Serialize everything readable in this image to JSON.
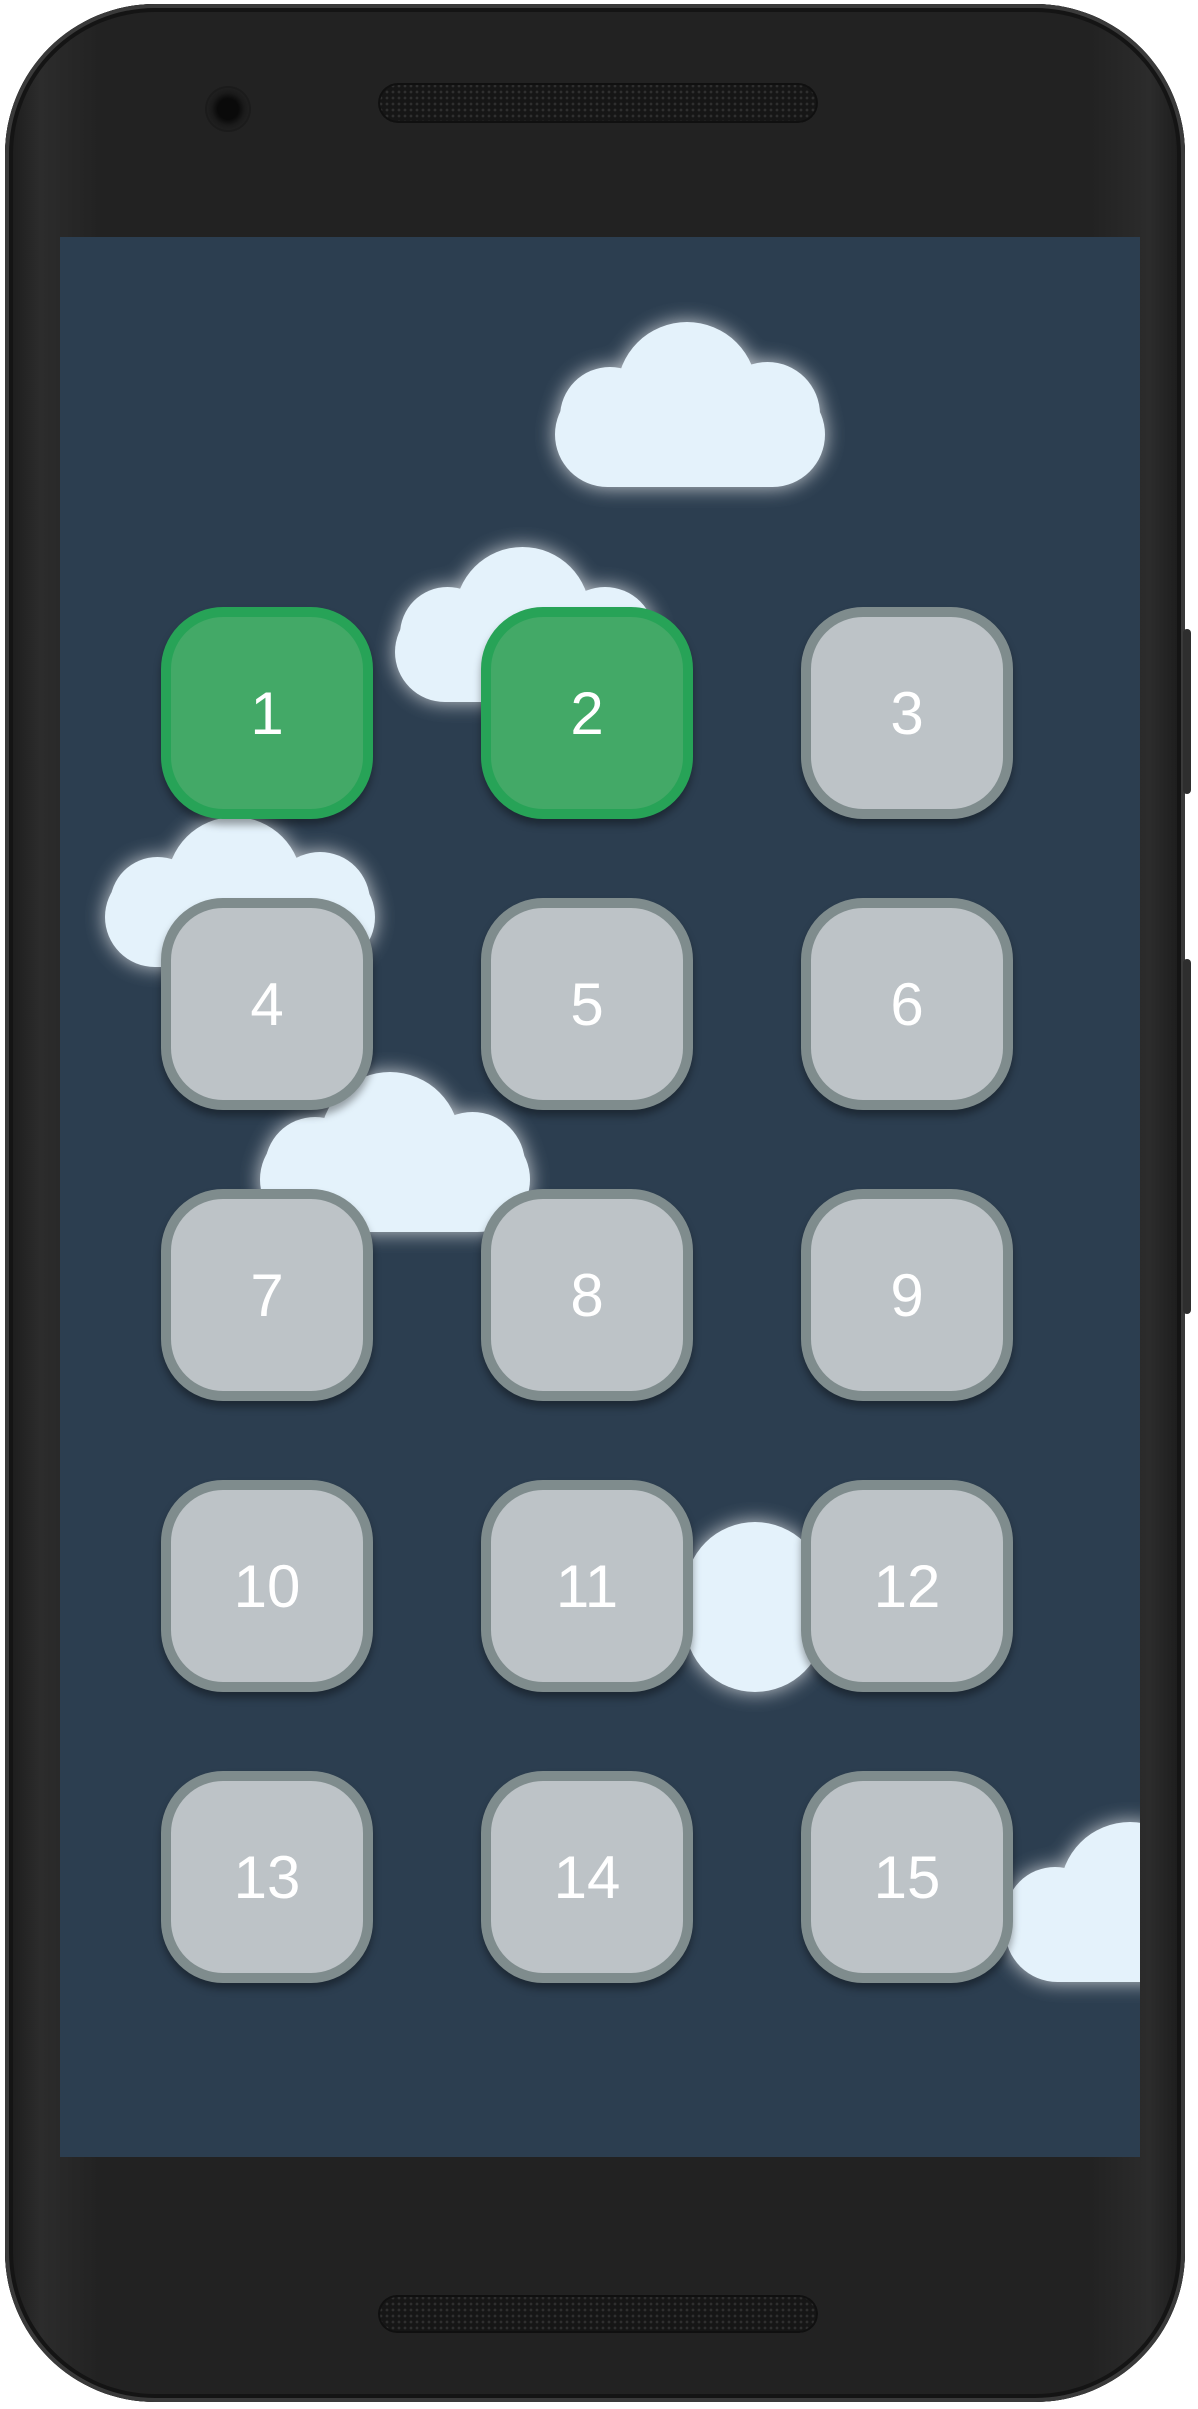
{
  "colors": {
    "screen_background": "#2c3e50",
    "level_unlocked_fill": "#43a967",
    "level_unlocked_border": "#27a357",
    "level_locked_fill": "#bdc3c7",
    "level_locked_border": "#7f8c8d",
    "level_text": "#ffffff",
    "cloud": "#e4f2fb"
  },
  "levels": [
    {
      "label": "1",
      "state": "unlocked"
    },
    {
      "label": "2",
      "state": "unlocked"
    },
    {
      "label": "3",
      "state": "locked"
    },
    {
      "label": "4",
      "state": "locked"
    },
    {
      "label": "5",
      "state": "locked"
    },
    {
      "label": "6",
      "state": "locked"
    },
    {
      "label": "7",
      "state": "locked"
    },
    {
      "label": "8",
      "state": "locked"
    },
    {
      "label": "9",
      "state": "locked"
    },
    {
      "label": "10",
      "state": "locked"
    },
    {
      "label": "11",
      "state": "locked"
    },
    {
      "label": "12",
      "state": "locked"
    },
    {
      "label": "13",
      "state": "locked"
    },
    {
      "label": "14",
      "state": "locked"
    },
    {
      "label": "15",
      "state": "locked"
    }
  ]
}
